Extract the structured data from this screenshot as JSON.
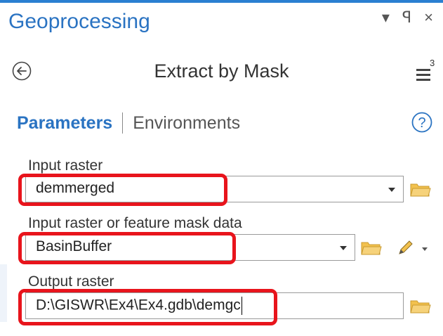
{
  "pane": {
    "title": "Geoprocessing",
    "controls": {
      "dropdown": "▾",
      "pin": "ꟼ",
      "close": "×"
    }
  },
  "tool": {
    "title": "Extract by Mask",
    "menu_badge": "3"
  },
  "tabs": {
    "parameters": "Parameters",
    "environments": "Environments"
  },
  "params": [
    {
      "label": "Input raster",
      "value": "demmerged"
    },
    {
      "label": "Input raster or feature mask data",
      "value": "BasinBuffer"
    },
    {
      "label": "Output raster",
      "value": "D:\\GISWR\\Ex4\\Ex4.gdb\\demgc"
    }
  ],
  "colors": {
    "accent": "#2a73c2",
    "highlight": "#e8141c",
    "folder": "#f2c14e"
  },
  "icons": [
    "back-arrow-icon",
    "menu-icon",
    "help-icon",
    "folder-icon",
    "pencil-icon",
    "dropdown-arrow-icon"
  ]
}
